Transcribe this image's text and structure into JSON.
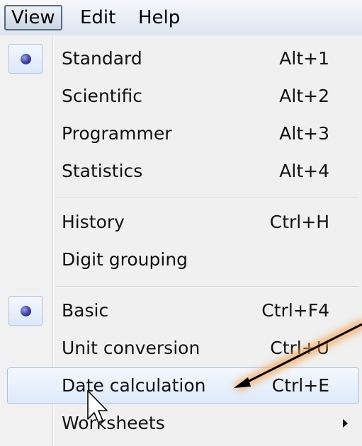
{
  "menubar": {
    "view": "View",
    "edit": "Edit",
    "help": "Help"
  },
  "menu": {
    "standard": {
      "label": "Standard",
      "shortcut": "Alt+1"
    },
    "scientific": {
      "label": "Scientific",
      "shortcut": "Alt+2"
    },
    "programmer": {
      "label": "Programmer",
      "shortcut": "Alt+3"
    },
    "statistics": {
      "label": "Statistics",
      "shortcut": "Alt+4"
    },
    "history": {
      "label": "History",
      "shortcut": "Ctrl+H"
    },
    "digit_grouping": {
      "label": "Digit grouping"
    },
    "basic": {
      "label": "Basic",
      "shortcut": "Ctrl+F4"
    },
    "unit_conversion": {
      "label": "Unit conversion",
      "shortcut": "Ctrl+U"
    },
    "date_calculation": {
      "label": "Date calculation",
      "shortcut": "Ctrl+E"
    },
    "worksheets": {
      "label": "Worksheets"
    }
  },
  "colors": {
    "radio_dot": "#3d3f9c",
    "highlight_border": "#a7c2e8",
    "annotation_glow": "#f4a35a",
    "annotation_arrow": "#000000"
  }
}
